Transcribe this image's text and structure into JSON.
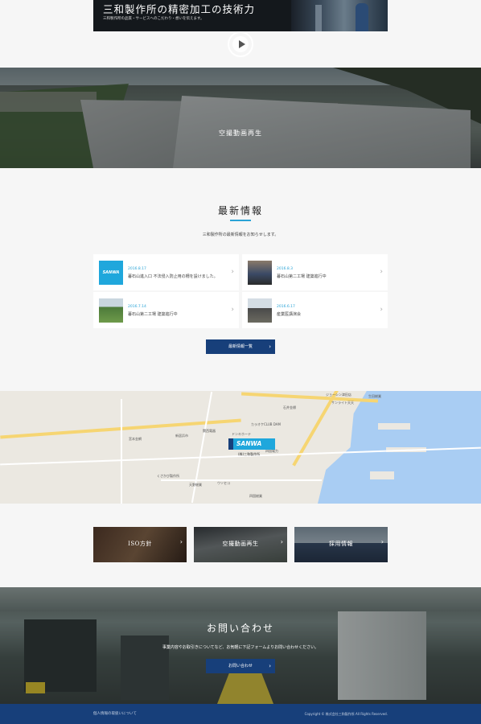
{
  "top_banner": {
    "title": "三和製作所の精密加工の技術力",
    "subtitle": "三和製作所の品質・サービスへのこだわり・想いを伝えます。"
  },
  "aerial_video": {
    "label": "空撮動画再生",
    "icon": "play-icon"
  },
  "news": {
    "title": "最新情報",
    "description": "三和製作所の最新情報をお知らせします。",
    "accent": "#2aa3d6",
    "items": [
      {
        "date": "2016.8.17",
        "text": "暮石山進入口 不法侵入防止用の柵を設けました。",
        "thumb": "sanwa-logo",
        "thumb_text": "SANWA"
      },
      {
        "date": "2016.8.3",
        "text": "暮石山第二工場 建築進行中",
        "thumb": "people-photo"
      },
      {
        "date": "2016.7.14",
        "text": "暮石山第二工場 建築進行中",
        "thumb": "field-photo"
      },
      {
        "date": "2016.6.17",
        "text": "産業医講演会",
        "thumb": "crowd-photo"
      }
    ],
    "more_label": "最新情報一覧"
  },
  "map": {
    "pin_label": "SANWA",
    "pin_caption": "(株)三和製作所",
    "labels": [
      "ジョーシン津田店",
      "サンライト天天",
      "石井金標",
      "カラオケCLUB DAM",
      "ドンキホーテ",
      "関西電器",
      "新居浜市",
      "宮本金網",
      "四国電力",
      "くさかび製作所",
      "ウソセコ",
      "生田総業",
      "天野総業",
      "四国総業"
    ]
  },
  "tiles": [
    {
      "label": "ISO方針"
    },
    {
      "label": "空撮動画再生"
    },
    {
      "label": "採用情報"
    }
  ],
  "contact": {
    "title": "お問い合わせ",
    "description": "事業内容やお取引きについてなど、お気軽に下記フォームよりお問い合わせください。",
    "button": "お問い合わせ"
  },
  "footer": {
    "privacy": "個人情報の取扱いについて",
    "copyright": "Copyright © 株式会社三和製作所 All Rights Reserved."
  },
  "colors": {
    "brand": "#173f7a",
    "accent": "#2aa3d6",
    "page_bg": "#f6f6f6"
  }
}
